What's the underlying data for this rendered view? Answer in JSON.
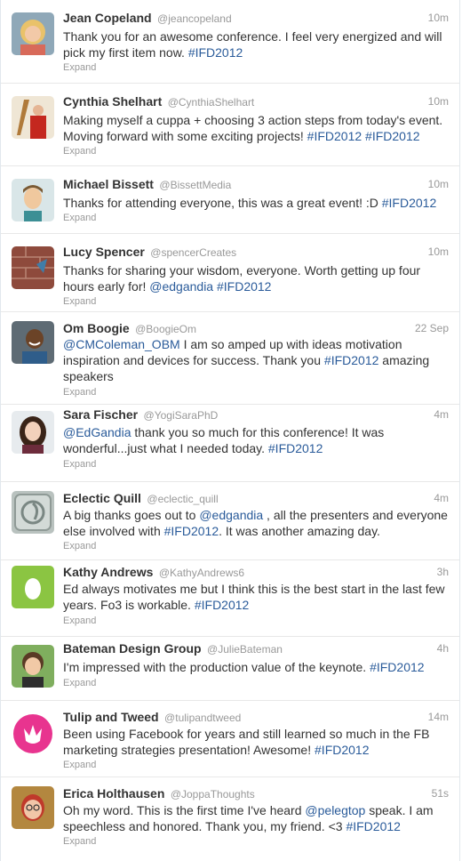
{
  "tweets": [
    {
      "name": "Jean Copeland",
      "handle": "@jeancopeland",
      "time": "10m",
      "text": [
        "Thank you for an awesome conference. I feel very energized and will",
        "pick my first item now. "
      ],
      "tag": "#IFD2012",
      "expand": "Expand",
      "avatar": "woman-blond-avatar"
    },
    {
      "name": "Cynthia Shelhart",
      "handle": "@CynthiaShelhart",
      "time": "10m",
      "text": [
        "Making myself a cuppa + choosing 3 action steps from today's event.",
        "Moving forward with some exciting projects! "
      ],
      "tags": [
        "#IFD2012",
        "#IFD2012"
      ],
      "expand": "Expand",
      "avatar": "woman-harp-avatar"
    },
    {
      "name": "Michael Bissett",
      "handle": "@BissettMedia",
      "time": "10m",
      "text": [
        "Thanks for attending everyone, this was a great event! :D "
      ],
      "tag": "#IFD2012",
      "expand": "Expand",
      "avatar": "man-cartoon-avatar"
    },
    {
      "name": "Lucy Spencer",
      "handle": "@spencerCreates",
      "time": "10m",
      "text": [
        "Thanks for sharing your wisdom, everyone. Worth getting up four",
        "hours early for! "
      ],
      "mention": "@edgandia",
      "tag": "#IFD2012",
      "expand": "Expand",
      "avatar": "brick-bird-avatar"
    },
    {
      "name": "Om Boogie",
      "handle": "@BoogieOm",
      "time": "22 Sep",
      "mention": "@CMColeman_OBM",
      "text": [
        " I am so amped up with ideas motivation",
        "inspiration and devices for success. Thank you ",
        " amazing",
        "speakers"
      ],
      "tag": "#IFD2012",
      "expand": "Expand",
      "avatar": "man-smiling-avatar"
    },
    {
      "name": "Sara Fischer",
      "handle": "@YogiSaraPhD",
      "time": "4m",
      "mention": "@EdGandia",
      "text": [
        " thank you so much for this conference! It was",
        "wonderful...just what I needed today. "
      ],
      "tag": "#IFD2012",
      "expand": "Expand",
      "avatar": "woman-dark-hair-avatar"
    },
    {
      "name": "Eclectic Quill",
      "handle": "@eclectic_quill",
      "time": "4m",
      "text": [
        "A big thanks goes out to ",
        " , all the presenters and everyone",
        "else involved with ",
        ". It was another amazing day."
      ],
      "mention": "@edgandia",
      "tag": "#IFD2012",
      "expand": "Expand",
      "avatar": "quill-logo-avatar"
    },
    {
      "name": "Kathy Andrews",
      "handle": "@KathyAndrews6",
      "time": "3h",
      "text": [
        "Ed always motivates me but I think this is the best start in the last few",
        "years. Fo3 is workable. "
      ],
      "tag": "#IFD2012",
      "expand": "Expand",
      "avatar": "default-egg-avatar"
    },
    {
      "name": "Bateman Design Group",
      "handle": "@JulieBateman",
      "time": "4h",
      "text": [
        "I'm impressed with the production value of the keynote. "
      ],
      "tag": "#IFD2012",
      "expand": "Expand",
      "avatar": "woman-short-hair-avatar"
    },
    {
      "name": "Tulip and Tweed",
      "handle": "@tulipandtweed",
      "time": "14m",
      "text": [
        "Been using Facebook for years and still learned so much in the FB",
        "marketing strategies presentation! Awesome! "
      ],
      "tag": "#IFD2012",
      "expand": "Expand",
      "avatar": "tulip-logo-avatar"
    },
    {
      "name": "Erica Holthausen",
      "handle": "@JoppaThoughts",
      "time": "51s",
      "text": [
        "Oh my word. This is the first time I've heard ",
        " speak. I am",
        "speechless and honored. Thank you, my friend. <3 "
      ],
      "mention": "@pelegtop",
      "tag": "#IFD2012",
      "expand": "Expand",
      "avatar": "woman-glasses-avatar"
    }
  ],
  "colors": {
    "link": "#2a5b9a",
    "name": "#333333",
    "muted": "#999999",
    "divider": "#e8e8e8"
  }
}
